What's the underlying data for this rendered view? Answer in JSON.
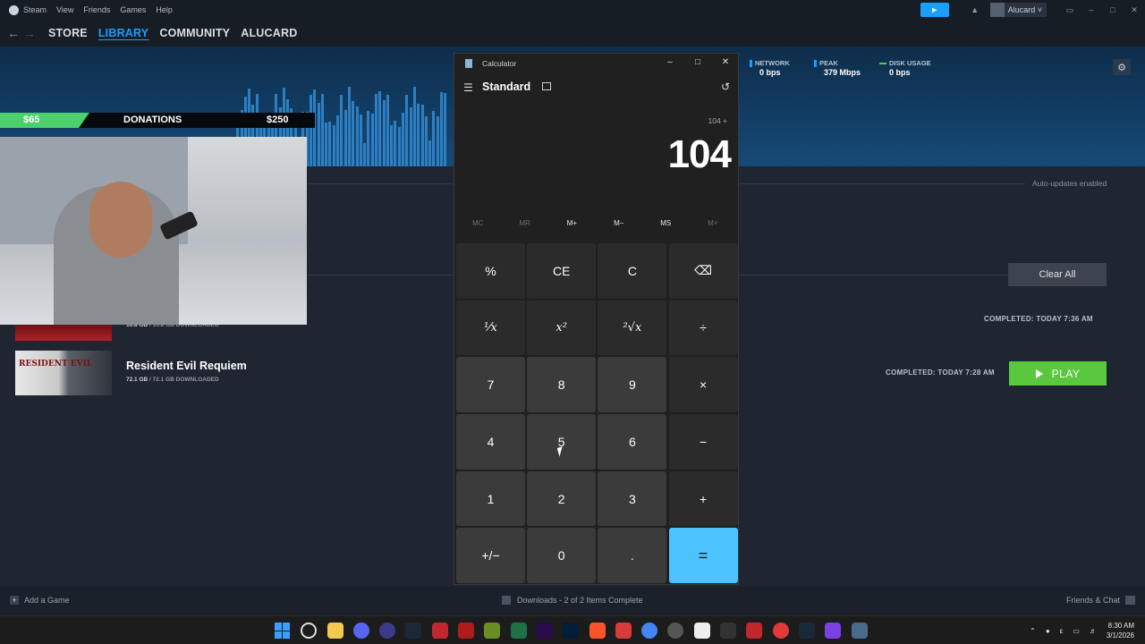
{
  "steam": {
    "menu": [
      "Steam",
      "View",
      "Friends",
      "Games",
      "Help"
    ],
    "user": "Alucard",
    "nav": [
      "STORE",
      "LIBRARY",
      "COMMUNITY",
      "ALUCARD"
    ],
    "stats": [
      {
        "label": "NETWORK",
        "value": "0 bps",
        "color": "#1a9fff"
      },
      {
        "label": "PEAK",
        "value": "379 Mbps",
        "color": "#1a9fff"
      },
      {
        "label": "DISK USAGE",
        "value": "0 bps",
        "color": "#5ac83f"
      }
    ],
    "auto_updates": "Auto-updates enabled",
    "clear_all": "Clear All",
    "completed_1": "COMPLETED: TODAY 7:36 AM",
    "completed_2": "COMPLETED: TODAY 7:28 AM",
    "play": "PLAY",
    "games": [
      {
        "name": "",
        "size_done": "10.8 GB",
        "size_total": "/ 10.8 GB DOWNLOADED"
      },
      {
        "name": "Resident Evil Requiem",
        "size_done": "72.1 GB",
        "size_total": "/ 72.1 GB DOWNLOADED",
        "thumb_text": "RESIDENT EVIL"
      }
    ],
    "add_game": "Add a Game",
    "downloads_status": "Downloads - 2 of 2 Items Complete",
    "friends_chat": "Friends & Chat"
  },
  "overlay": {
    "amount_left": "$65",
    "label": "DONATIONS",
    "amount_right": "$250"
  },
  "calculator": {
    "title": "Calculator",
    "mode": "Standard",
    "expression": "104 +",
    "display": "104",
    "memory": [
      "MC",
      "MR",
      "M+",
      "M−",
      "MS",
      "M˅"
    ],
    "keys": [
      "%",
      "CE",
      "C",
      "⌫",
      "⅟x",
      "x²",
      "²√x",
      "÷",
      "7",
      "8",
      "9",
      "×",
      "4",
      "5",
      "6",
      "−",
      "1",
      "2",
      "3",
      "+",
      "+/−",
      "0",
      ".",
      "="
    ]
  },
  "taskbar": {
    "clock_time": "8:30 AM",
    "clock_date": "3/1/2026"
  }
}
